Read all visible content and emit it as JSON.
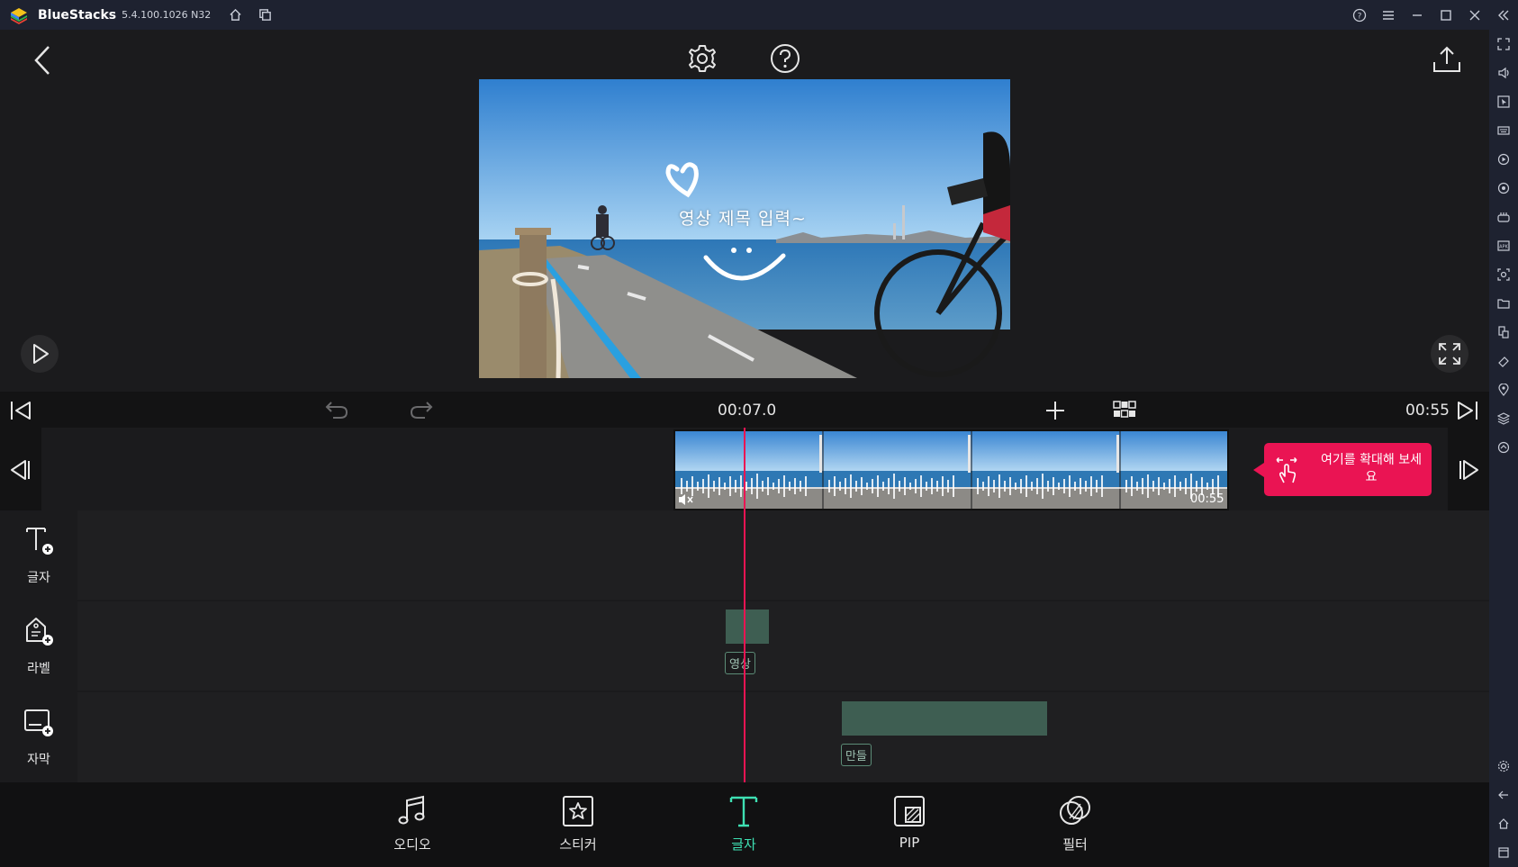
{
  "titlebar": {
    "app_name": "BlueStacks",
    "version": "5.4.100.1026 N32"
  },
  "editor": {
    "video_title_overlay": "영상 제목 입력~",
    "current_time": "00:07.0",
    "total_time": "00:55",
    "clip_duration": "00:55",
    "zoom_tooltip": "여기를 확대해 보세요"
  },
  "tracks": [
    {
      "label": "글자",
      "icon": "text-add-icon"
    },
    {
      "label": "라벨",
      "icon": "label-add-icon",
      "clip_tag": "영상"
    },
    {
      "label": "자막",
      "icon": "subtitle-add-icon",
      "clip_tag": "만들"
    }
  ],
  "toolbar": [
    {
      "label": "오디오",
      "icon": "music-note-icon",
      "active": false
    },
    {
      "label": "스티커",
      "icon": "sticker-star-icon",
      "active": false
    },
    {
      "label": "글자",
      "icon": "text-t-icon",
      "active": true
    },
    {
      "label": "PIP",
      "icon": "pip-icon",
      "active": false
    },
    {
      "label": "필터",
      "icon": "filter-icon",
      "active": false
    }
  ],
  "colors": {
    "accent": "#ea1453",
    "active_tool": "#3ee0b3",
    "clip": "#3e5e52"
  }
}
